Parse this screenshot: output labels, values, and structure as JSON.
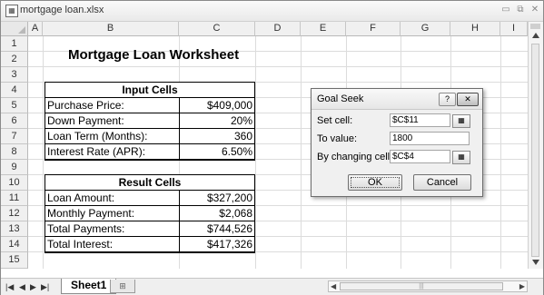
{
  "window": {
    "title": "mortgage loan.xlsx"
  },
  "grid": {
    "columns": [
      "A",
      "B",
      "C",
      "D",
      "E",
      "F",
      "G",
      "H",
      "I"
    ],
    "rows": [
      "1",
      "2",
      "3",
      "4",
      "5",
      "6",
      "7",
      "8",
      "9",
      "10",
      "11",
      "12",
      "13",
      "14",
      "15"
    ]
  },
  "sheet": {
    "title": "Mortgage Loan Worksheet",
    "input_table": {
      "header": "Input Cells",
      "rows": [
        {
          "label": "Purchase Price:",
          "value": "$409,000"
        },
        {
          "label": "Down Payment:",
          "value": "20%"
        },
        {
          "label": "Loan Term (Months):",
          "value": "360"
        },
        {
          "label": "Interest Rate (APR):",
          "value": "6.50%"
        }
      ]
    },
    "result_table": {
      "header": "Result Cells",
      "rows": [
        {
          "label": "Loan Amount:",
          "value": "$327,200"
        },
        {
          "label": "Monthly Payment:",
          "value": "$2,068"
        },
        {
          "label": "Total Payments:",
          "value": "$744,526"
        },
        {
          "label": "Total Interest:",
          "value": "$417,326"
        }
      ]
    }
  },
  "goal_seek": {
    "title": "Goal Seek",
    "help": "?",
    "close": "✕",
    "set_cell_label": "Set cell:",
    "set_cell_value": "$C$11",
    "to_value_label": "To value:",
    "to_value_value": "1800",
    "changing_cell_label": "By changing cell:",
    "changing_cell_value": "$C$4",
    "ok_label": "OK",
    "cancel_label": "Cancel"
  },
  "tabs": {
    "active": "Sheet1"
  },
  "icons": [
    "excel-file-icon",
    "minimize-icon",
    "restore-icon",
    "close-icon",
    "range-select-icon",
    "first-sheet-icon",
    "prev-sheet-icon",
    "next-sheet-icon",
    "last-sheet-icon",
    "insert-sheet-icon"
  ]
}
